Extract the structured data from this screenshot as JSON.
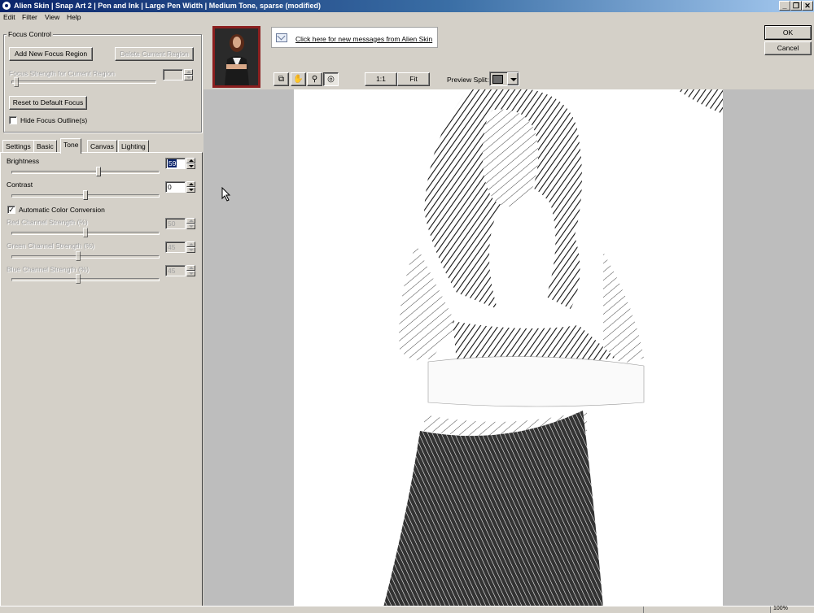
{
  "window": {
    "title": "Alien Skin | Snap Art 2 | Pen and Ink | Large Pen Width | Medium Tone, sparse (modified)",
    "controls": [
      "_",
      "❐",
      "✕"
    ]
  },
  "menu": [
    "Edit",
    "Filter",
    "View",
    "Help"
  ],
  "focus_control": {
    "group_label": "Focus Control",
    "add_region": "Add New Focus Region",
    "delete_region": "Delete Current Region",
    "strength_label": "Focus Strength for Current Region",
    "reset": "Reset to Default Focus",
    "hide_outlines": "Hide Focus Outline(s)",
    "hide_outlines_checked": false
  },
  "tabs": [
    "Settings",
    "Basic",
    "Tone",
    "Canvas",
    "Lighting"
  ],
  "active_tab": "Tone",
  "tone": {
    "brightness": {
      "label": "Brightness",
      "value": "59",
      "level": 0.59
    },
    "contrast": {
      "label": "Contrast",
      "value": "0",
      "level": 0.5
    },
    "auto_color": {
      "label": "Automatic Color Conversion",
      "checked": true,
      "mark": "✓"
    },
    "red": {
      "label": "Red Channel Strength (%)",
      "value": "50",
      "level": 0.5
    },
    "green": {
      "label": "Green Channel Strength (%)",
      "value": "45",
      "level": 0.45
    },
    "blue": {
      "label": "Blue Channel Strength (%)",
      "value": "45",
      "level": 0.45
    }
  },
  "messages_link": "Click here for new messages from Alien Skin",
  "toolbar": {
    "zoom_1_1": "1:1",
    "fit": "Fit",
    "preview_split_label": "Preview Split:"
  },
  "buttons": {
    "ok": "OK",
    "cancel": "Cancel"
  },
  "status": {
    "zoom": "100%"
  },
  "colors": {
    "title_start": "#0a246a",
    "title_end": "#a6caf0",
    "panel": "#d4d0c8",
    "preview_bg": "#bdbdbd"
  }
}
